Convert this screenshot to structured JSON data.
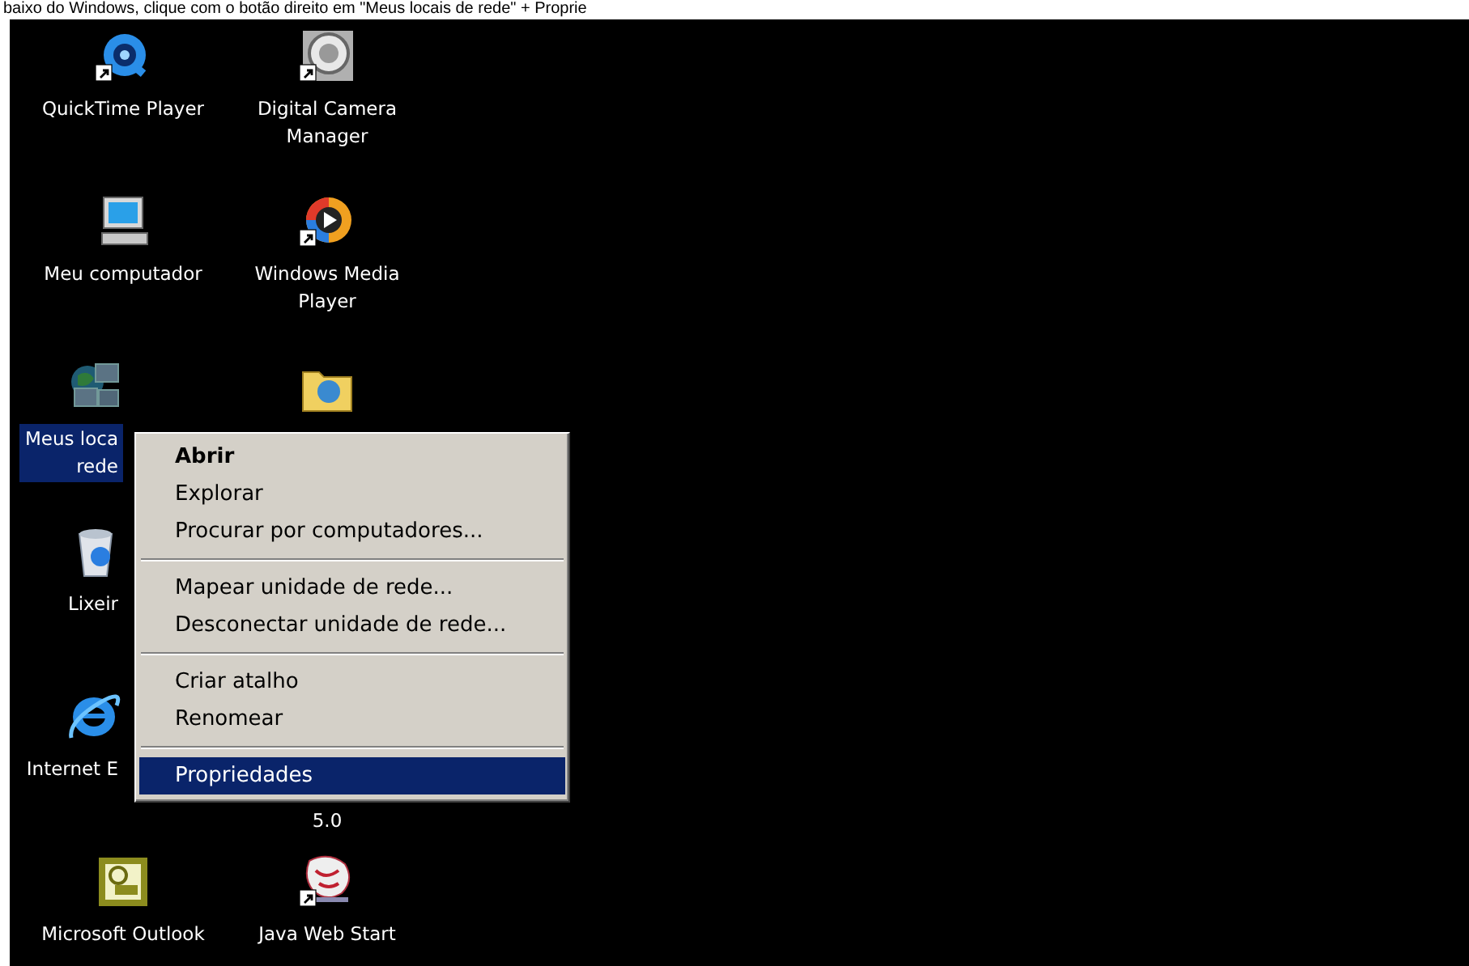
{
  "caption": "baixo do Windows, clique com o botão direito em \"Meus locais de rede\" + Proprie",
  "desktop_icons": [
    {
      "kind": "quicktime",
      "shortcut": true,
      "label": [
        "QuickTime Player"
      ],
      "selected": false,
      "covered": false
    },
    {
      "kind": "computer",
      "shortcut": false,
      "label": [
        "Meu computador"
      ],
      "selected": false,
      "covered": false
    },
    {
      "kind": "network",
      "shortcut": false,
      "label": [
        "Meus loca",
        "rede"
      ],
      "selected": true,
      "covered": true
    },
    {
      "kind": "recycle",
      "shortcut": false,
      "label": [
        "Lixeir"
      ],
      "selected": false,
      "covered": true
    },
    {
      "kind": "browser",
      "shortcut": false,
      "label": [
        "Internet E"
      ],
      "selected": false,
      "covered": true
    },
    {
      "kind": "outlook",
      "shortcut": false,
      "label": [
        "Microsoft Outlook"
      ],
      "selected": false,
      "covered": false
    },
    {
      "kind": "camera",
      "shortcut": true,
      "label": [
        "Digital Camera",
        "Manager"
      ],
      "selected": false,
      "covered": false
    },
    {
      "kind": "media",
      "shortcut": true,
      "label": [
        "Windows Media",
        "Player"
      ],
      "selected": false,
      "covered": false
    },
    {
      "kind": "folder",
      "shortcut": false
    },
    {
      "label": [
        "5.0"
      ],
      "selected": false,
      "covered": false
    },
    {
      "kind": "java",
      "shortcut": true,
      "label": [
        "Java Web Start"
      ],
      "selected": false,
      "covered": false
    }
  ],
  "context_menu": [
    {
      "kind": "item",
      "label": "Abrir",
      "default": true,
      "selected": false
    },
    {
      "kind": "item",
      "label": "Explorar",
      "default": false,
      "selected": false
    },
    {
      "kind": "item",
      "label": "Procurar por computadores...",
      "default": false,
      "selected": false
    },
    {
      "kind": "separator"
    },
    {
      "kind": "item",
      "label": "Mapear unidade de rede...",
      "default": false,
      "selected": false
    },
    {
      "kind": "item",
      "label": "Desconectar unidade de rede...",
      "default": false,
      "selected": false
    },
    {
      "kind": "separator"
    },
    {
      "kind": "item",
      "label": "Criar atalho",
      "default": false,
      "selected": false
    },
    {
      "kind": "item",
      "label": "Renomear",
      "default": false,
      "selected": false
    },
    {
      "kind": "separator"
    },
    {
      "kind": "item",
      "label": "Propriedades",
      "default": false,
      "selected": true
    }
  ]
}
